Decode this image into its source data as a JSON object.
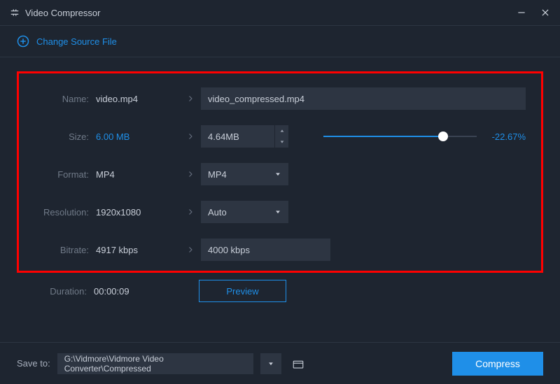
{
  "titlebar": {
    "title": "Video Compressor"
  },
  "source": {
    "change_label": "Change Source File"
  },
  "labels": {
    "name": "Name:",
    "size": "Size:",
    "format": "Format:",
    "resolution": "Resolution:",
    "bitrate": "Bitrate:",
    "duration": "Duration:"
  },
  "original": {
    "name": "video.mp4",
    "size": "6.00 MB",
    "format": "MP4",
    "resolution": "1920x1080",
    "bitrate": "4917 kbps",
    "duration": "00:00:09"
  },
  "output": {
    "name": "video_compressed.mp4",
    "size": "4.64MB",
    "format": "MP4",
    "resolution": "Auto",
    "bitrate": "4000 kbps",
    "percent": "-22.67%"
  },
  "buttons": {
    "preview": "Preview",
    "compress": "Compress"
  },
  "saveto": {
    "label": "Save to:",
    "path": "G:\\Vidmore\\Vidmore Video Converter\\Compressed"
  }
}
